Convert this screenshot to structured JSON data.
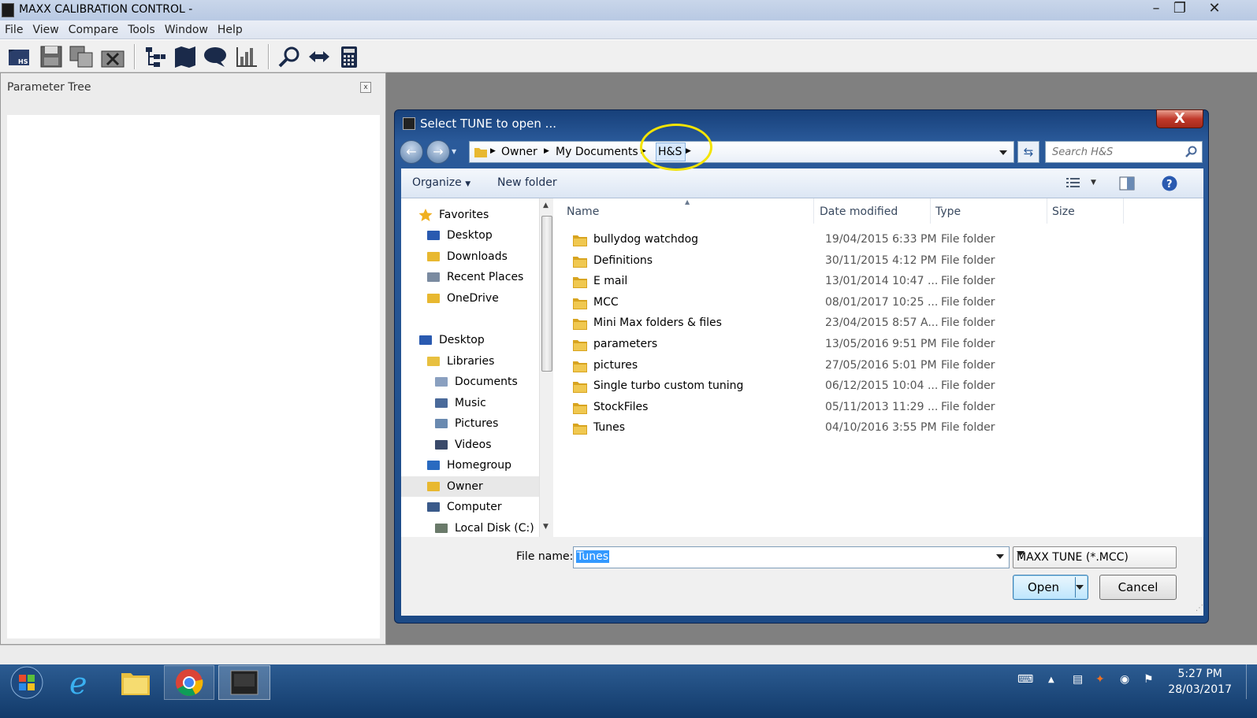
{
  "app": {
    "title": "MAXX CALIBRATION CONTROL -",
    "menu": [
      "File",
      "View",
      "Compare",
      "Tools",
      "Window",
      "Help"
    ]
  },
  "toolbar": {
    "icons": [
      "open-tune-icon",
      "save-icon",
      "copy-icon",
      "close-file-icon",
      "tree-icon",
      "map-book-icon",
      "chat-icon",
      "chart-icon",
      "search-zoom-icon",
      "compare-arrows-icon",
      "calculator-icon"
    ]
  },
  "parameter_tree": {
    "title": "Parameter Tree",
    "close_glyph": "x"
  },
  "dialog": {
    "title": "Select TUNE to open ...",
    "close_glyph": "X",
    "breadcrumb": [
      "Owner",
      "My Documents",
      "H&S"
    ],
    "search_placeholder": "Search H&S",
    "organize_label": "Organize",
    "new_folder_label": "New folder",
    "nav_items": [
      {
        "label": "Favorites",
        "icon": "star-icon",
        "indent": 0,
        "group": "favorites"
      },
      {
        "label": "Desktop",
        "icon": "desktop-icon",
        "indent": 1
      },
      {
        "label": "Downloads",
        "icon": "downloads-icon",
        "indent": 1
      },
      {
        "label": "Recent Places",
        "icon": "recent-places-icon",
        "indent": 1
      },
      {
        "label": "OneDrive",
        "icon": "onedrive-icon",
        "indent": 1
      },
      {
        "label": "Desktop",
        "icon": "desktop-icon",
        "indent": 0,
        "group": "desktop"
      },
      {
        "label": "Libraries",
        "icon": "libraries-icon",
        "indent": 1
      },
      {
        "label": "Documents",
        "icon": "documents-icon",
        "indent": 2
      },
      {
        "label": "Music",
        "icon": "music-icon",
        "indent": 2
      },
      {
        "label": "Pictures",
        "icon": "pictures-icon",
        "indent": 2
      },
      {
        "label": "Videos",
        "icon": "videos-icon",
        "indent": 2
      },
      {
        "label": "Homegroup",
        "icon": "homegroup-icon",
        "indent": 1
      },
      {
        "label": "Owner",
        "icon": "user-folder-icon",
        "indent": 1,
        "selected": true
      },
      {
        "label": "Computer",
        "icon": "computer-icon",
        "indent": 1
      },
      {
        "label": "Local Disk (C:)",
        "icon": "disk-icon",
        "indent": 2
      }
    ],
    "columns": [
      "Name",
      "Date modified",
      "Type",
      "Size"
    ],
    "files": [
      {
        "name": "bullydog watchdog",
        "date": "19/04/2015 6:33 PM",
        "type": "File folder"
      },
      {
        "name": "Definitions",
        "date": "30/11/2015 4:12 PM",
        "type": "File folder"
      },
      {
        "name": "E mail",
        "date": "13/01/2014 10:47 ...",
        "type": "File folder"
      },
      {
        "name": "MCC",
        "date": "08/01/2017 10:25 ...",
        "type": "File folder"
      },
      {
        "name": "Mini Max folders & files",
        "date": "23/04/2015 8:57 A...",
        "type": "File folder"
      },
      {
        "name": "parameters",
        "date": "13/05/2016 9:51 PM",
        "type": "File folder"
      },
      {
        "name": "pictures",
        "date": "27/05/2016 5:01 PM",
        "type": "File folder"
      },
      {
        "name": "Single turbo custom tuning",
        "date": "06/12/2015 10:04 ...",
        "type": "File folder"
      },
      {
        "name": "StockFiles",
        "date": "05/11/2013 11:29 ...",
        "type": "File folder"
      },
      {
        "name": "Tunes",
        "date": "04/10/2016 3:55 PM",
        "type": "File folder"
      }
    ],
    "file_name_label": "File name:",
    "file_name_value": "Tunes",
    "file_type_value": "MAXX TUNE (*.MCC)",
    "open_label": "Open",
    "cancel_label": "Cancel"
  },
  "taskbar": {
    "clock_time": "5:27 PM",
    "clock_date": "28/03/2017",
    "items": [
      "start-orb-icon",
      "internet-explorer-icon",
      "file-explorer-icon",
      "chrome-icon",
      "maxx-app-icon"
    ]
  },
  "colors": {
    "highlight_ring": "#f4e400",
    "dialog_frame": "#1c4a86",
    "selection": "#3399ff"
  }
}
